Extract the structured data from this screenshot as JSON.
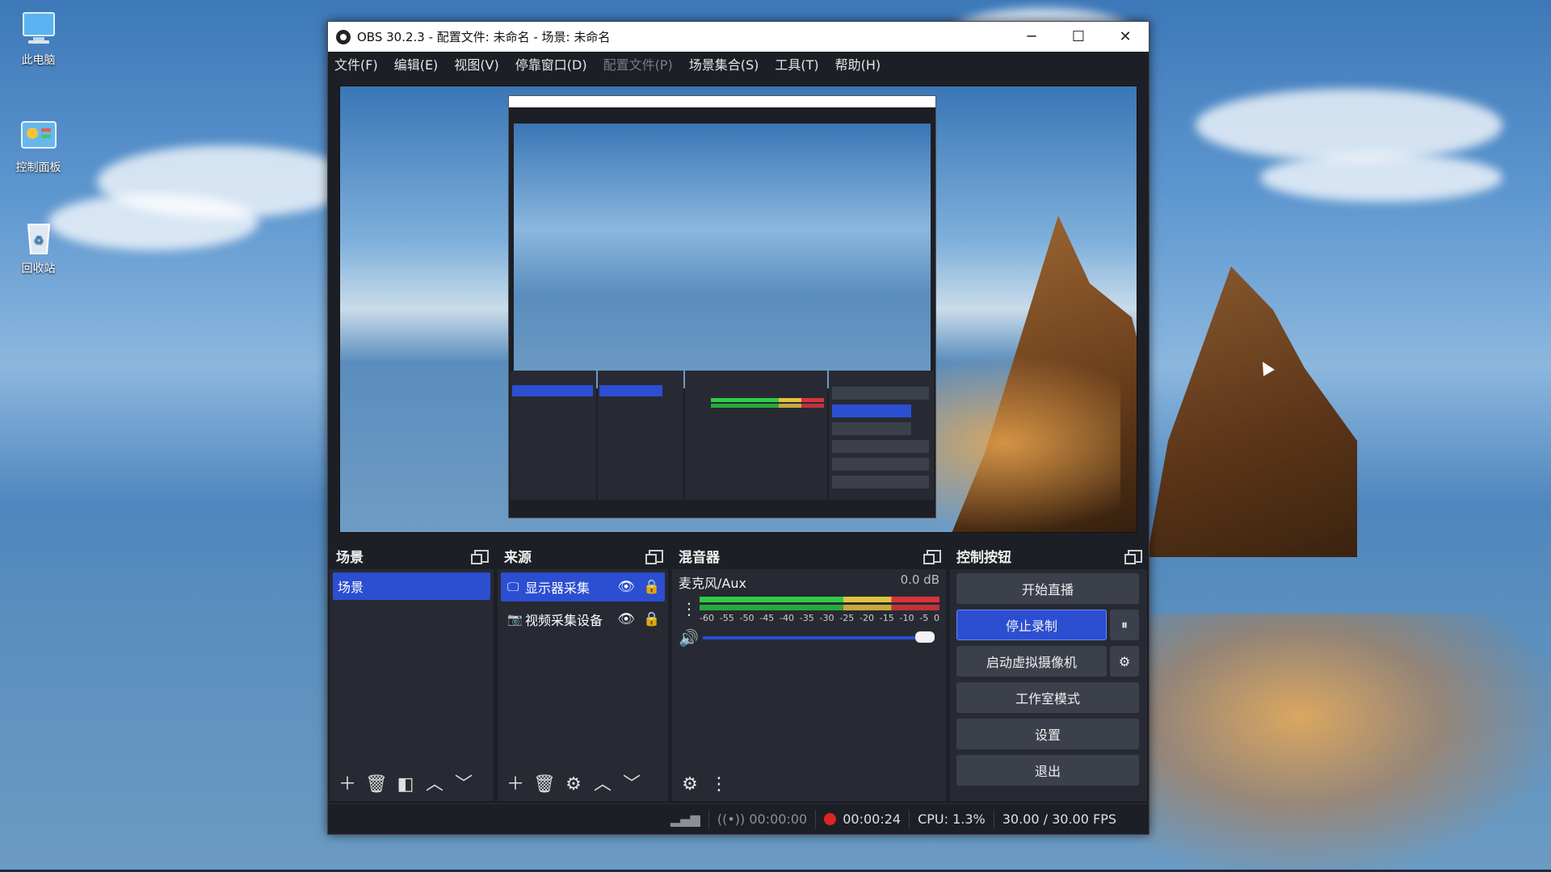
{
  "desktop": {
    "icons": [
      {
        "label": "此电脑",
        "icon": "computer-icon"
      },
      {
        "label": "控制面板",
        "icon": "control-panel-icon"
      },
      {
        "label": "回收站",
        "icon": "recycle-bin-icon"
      }
    ]
  },
  "window": {
    "title": "OBS 30.2.3 - 配置文件: 未命名 - 场景: 未命名",
    "minimize": "─",
    "maximize": "☐",
    "close": "✕"
  },
  "menu": {
    "items": [
      "文件(F)",
      "编辑(E)",
      "视图(V)",
      "停靠窗口(D)",
      "配置文件(P)",
      "场景集合(S)",
      "工具(T)",
      "帮助(H)"
    ]
  },
  "scenes": {
    "title": "场景",
    "items": [
      "场景"
    ]
  },
  "sources": {
    "title": "来源",
    "items": [
      {
        "label": "显示器采集",
        "icon": "monitor-icon"
      },
      {
        "label": "视频采集设备",
        "icon": "camera-icon"
      }
    ]
  },
  "mixer": {
    "title": "混音器",
    "channel": "麦克风/Aux",
    "db": "0.0 dB",
    "ticks": [
      "-60",
      "-55",
      "-50",
      "-45",
      "-40",
      "-35",
      "-30",
      "-25",
      "-20",
      "-15",
      "-10",
      "-5",
      "0"
    ],
    "volume": 1.0
  },
  "controls": {
    "title": "控制按钮",
    "start_stream": "开始直播",
    "stop_record": "停止录制",
    "pause": "⏸",
    "virtual_cam": "启动虚拟摄像机",
    "studio_mode": "工作室模式",
    "settings": "设置",
    "exit": "退出"
  },
  "status": {
    "stream_time": "00:00:00",
    "rec_time": "00:00:24",
    "cpu": "CPU: 1.3%",
    "fps": "30.00 / 30.00 FPS"
  },
  "colors": {
    "accent": "#2c4ed1",
    "panel": "#272a33",
    "rec": "#e02424"
  }
}
